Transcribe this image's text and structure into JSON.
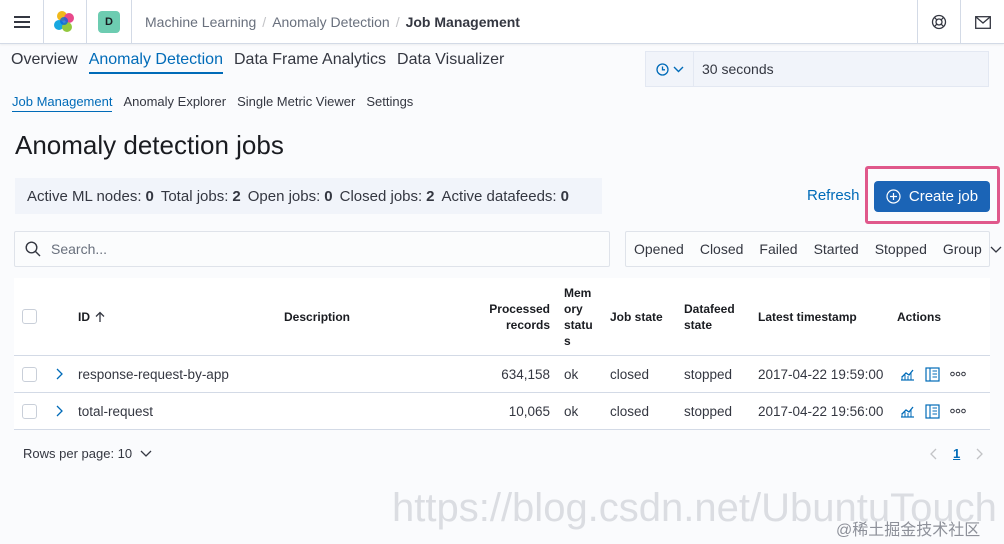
{
  "header": {
    "space_initial": "D",
    "breadcrumbs": [
      "Machine Learning",
      "Anomaly Detection",
      "Job Management"
    ]
  },
  "main_tabs": [
    "Overview",
    "Anomaly Detection",
    "Data Frame Analytics",
    "Data Visualizer"
  ],
  "sub_tabs": [
    "Job Management",
    "Anomaly Explorer",
    "Single Metric Viewer",
    "Settings"
  ],
  "refresh_interval": "30 seconds",
  "page_title": "Anomaly detection jobs",
  "stats": [
    {
      "label": "Active ML nodes:",
      "value": "0"
    },
    {
      "label": "Total jobs:",
      "value": "2"
    },
    {
      "label": "Open jobs:",
      "value": "0"
    },
    {
      "label": "Closed jobs:",
      "value": "2"
    },
    {
      "label": "Active datafeeds:",
      "value": "0"
    }
  ],
  "refresh_label": "Refresh",
  "create_job_label": "Create job",
  "search_placeholder": "Search...",
  "filters": {
    "state": [
      "Opened",
      "Closed",
      "Failed"
    ],
    "datafeed": [
      "Started",
      "Stopped"
    ],
    "group": "Group"
  },
  "table": {
    "headers": {
      "id": "ID",
      "description": "Description",
      "processed_1": "Processed",
      "processed_2": "records",
      "memory_1": "Mem",
      "memory_2": "ory",
      "memory_3": "statu",
      "memory_4": "s",
      "job_state": "Job state",
      "datafeed_1": "Datafeed",
      "datafeed_2": "state",
      "latest": "Latest timestamp",
      "actions": "Actions"
    },
    "rows": [
      {
        "id": "response-request-by-app",
        "description": "",
        "processed": "634,158",
        "memory": "ok",
        "job_state": "closed",
        "datafeed": "stopped",
        "latest": "2017-04-22 19:59:00"
      },
      {
        "id": "total-request",
        "description": "",
        "processed": "10,065",
        "memory": "ok",
        "job_state": "closed",
        "datafeed": "stopped",
        "latest": "2017-04-22 19:56:00"
      }
    ]
  },
  "rows_per_page": "Rows per page: 10",
  "current_page": "1",
  "watermark": "https://blog.csdn.net/UbuntuTouch",
  "credit": "@稀土掘金技术社区",
  "colors": {
    "primary": "#1b64b6",
    "link": "#006bb8",
    "highlight": "#e0588b"
  }
}
